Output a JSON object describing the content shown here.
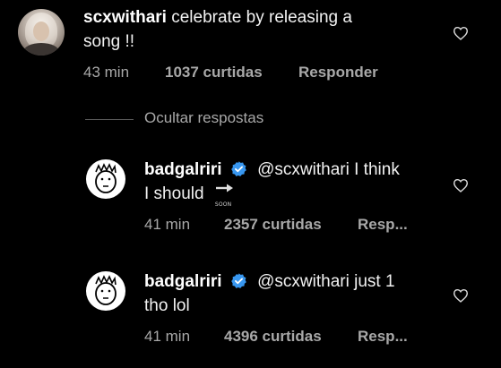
{
  "comments": [
    {
      "username": "scxwithari",
      "text_line1": " celebrate by releasing a",
      "text_line2": "song !!",
      "time": "43 min",
      "likes": "1037 curtidas",
      "reply": "Responder"
    }
  ],
  "replies_toggle": "Ocultar respostas",
  "replies": [
    {
      "username": "badgalriri",
      "mention": "@scxwithari",
      "text_line1_rest": " I think",
      "text_line2": "I should",
      "emoji": "soon-arrow-icon",
      "emoji_text": "SOON",
      "time": "41 min",
      "likes": "2357 curtidas",
      "reply": "Resp..."
    },
    {
      "username": "badgalriri",
      "mention": "@scxwithari",
      "text_line1_rest": " just 1",
      "text_line2": "tho lol",
      "time": "41 min",
      "likes": "4396 curtidas",
      "reply": "Resp..."
    }
  ],
  "colors": {
    "background": "#000000",
    "text": "#f2f2f2",
    "muted": "#a8a8a8",
    "verified": "#3897f0"
  }
}
